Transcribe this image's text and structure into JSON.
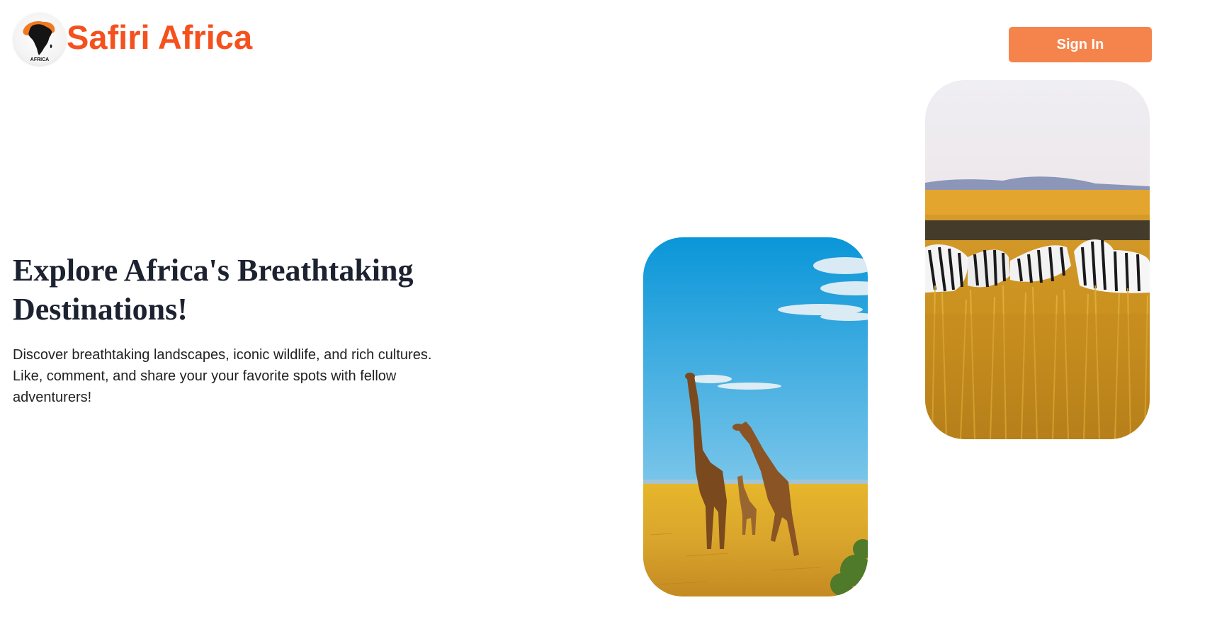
{
  "header": {
    "logo_icon": "africa-map-logo-icon",
    "logo_text": "AFRICA",
    "brand_name": "Safiri Africa",
    "sign_in_label": "Sign In"
  },
  "hero": {
    "title": "Explore Africa's Breathtaking Destinations!",
    "description": "Discover breathtaking landscapes, iconic wildlife, and rich cultures. Like, comment, and share your your favorite spots with fellow adventurers!"
  },
  "images": [
    {
      "name": "giraffes-savanna-photo"
    },
    {
      "name": "zebras-grassland-photo"
    }
  ],
  "colors": {
    "brand": "#f4511e",
    "button": "#f5844c",
    "heading": "#1c2230"
  }
}
